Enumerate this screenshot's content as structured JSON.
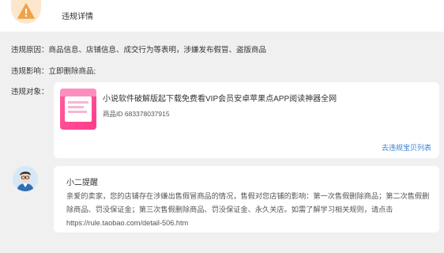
{
  "header": {
    "title": "违规详情",
    "icon": "warning-icon"
  },
  "violation": {
    "reason_label": "违规原因：",
    "reason_value": "商品信息、店铺信息、成交行为等表明，涉嫌发布假冒、盗版商品",
    "impact_label": "违规影响：",
    "impact_value": "立即删除商品;",
    "target_label": "违规对象："
  },
  "product": {
    "title": "小说软件破解版起下载免费看VIP会员安卓苹果点APP阅读神器全网",
    "id_text": "商品ID 683378037915",
    "link_label": "去违规宝贝列表"
  },
  "message": {
    "sender": "小二提醒",
    "body": "亲爱的卖家，您的店铺存在涉嫌出售假冒商品的情况，售假对您店铺的影响：第一次售假删除商品；第二次售假删除商品、罚没保证金；第三次售假删除商品、罚没保证金、永久关店。如需了解学习相关规则，请点击https://rule.taobao.com/detail-506.htm"
  },
  "colors": {
    "accent_link": "#3b82d6",
    "warning": "#f0a24b",
    "warning_bg": "#fde7cc"
  }
}
